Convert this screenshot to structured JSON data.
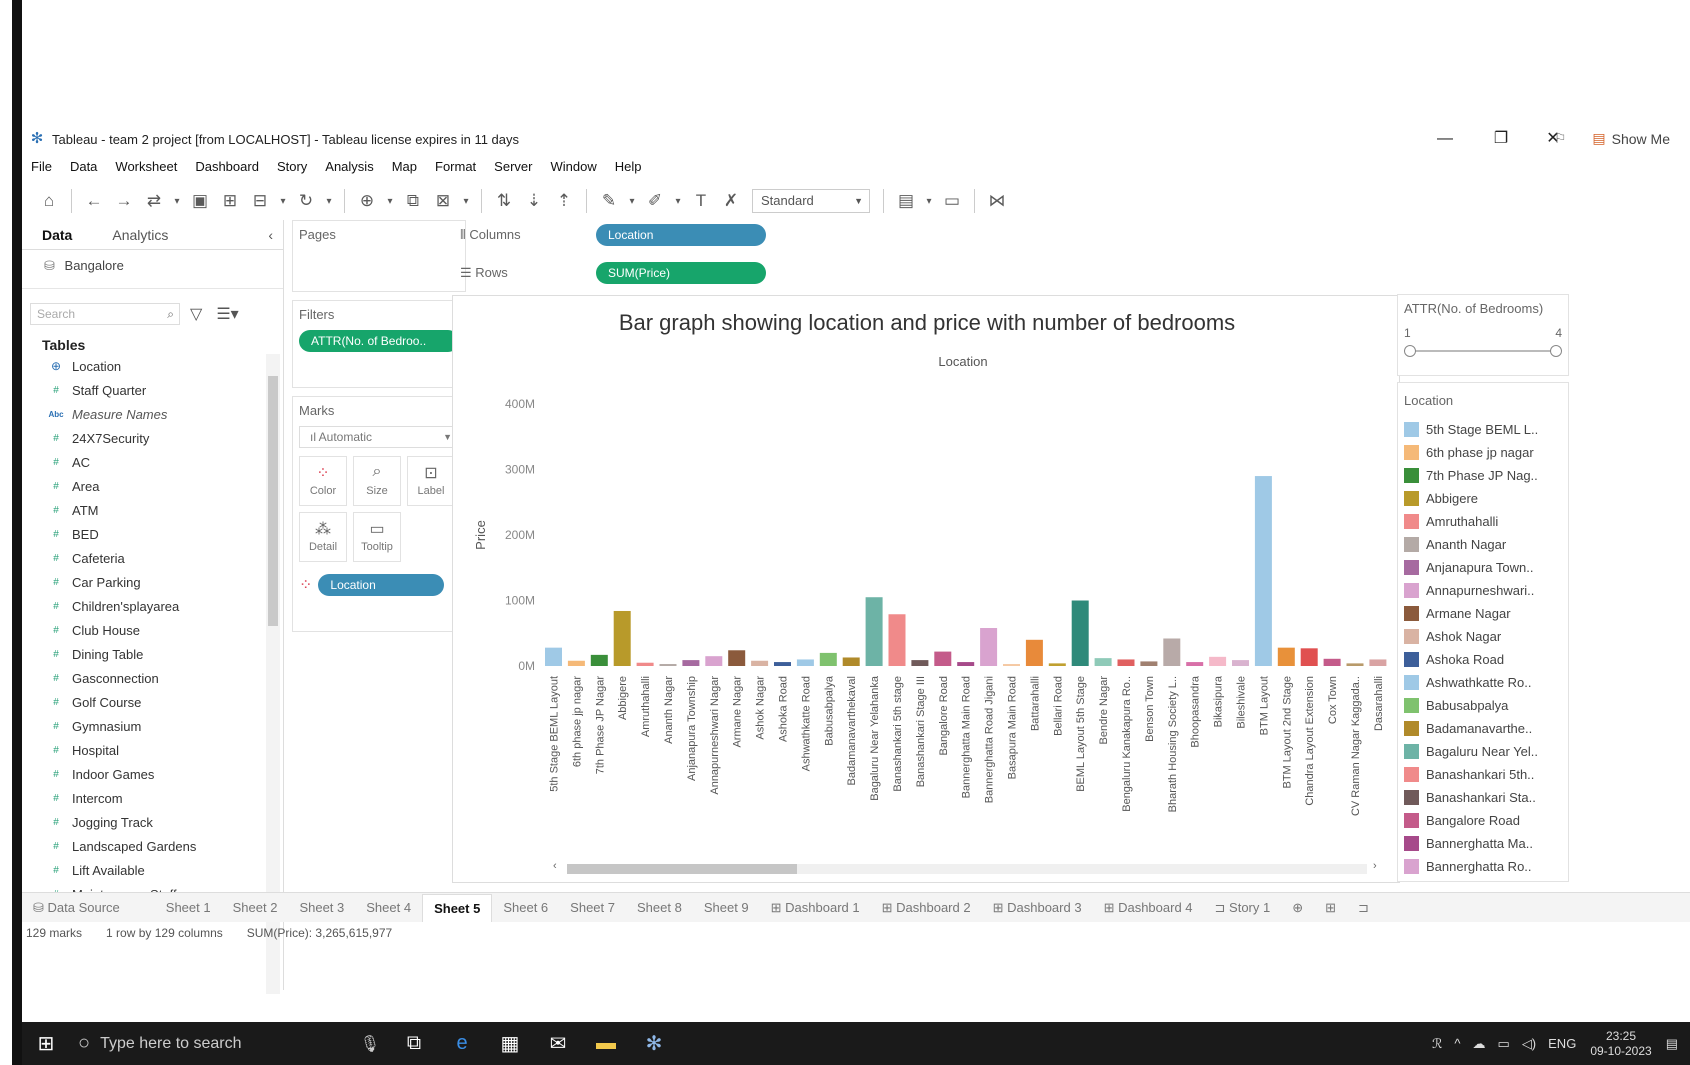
{
  "window": {
    "title": "Tableau - team 2 project [from LOCALHOST] - Tableau license expires in 11 days",
    "controls": [
      "—",
      "❐",
      "✕"
    ]
  },
  "menu": [
    "File",
    "Data",
    "Worksheet",
    "Dashboard",
    "Story",
    "Analysis",
    "Map",
    "Format",
    "Server",
    "Window",
    "Help"
  ],
  "toolbar": {
    "fit_select": "Standard",
    "show_me": "Show Me"
  },
  "data_pane": {
    "tabs": [
      "Data",
      "Analytics"
    ],
    "datasource": "Bangalore",
    "search_placeholder": "Search",
    "tables_heading": "Tables",
    "fields": [
      {
        "name": "Location",
        "type": "geo"
      },
      {
        "name": "Staff Quarter",
        "type": "num"
      },
      {
        "name": "Measure Names",
        "type": "abc"
      },
      {
        "name": "24X7Security",
        "type": "num"
      },
      {
        "name": "AC",
        "type": "num"
      },
      {
        "name": "Area",
        "type": "num"
      },
      {
        "name": "ATM",
        "type": "num"
      },
      {
        "name": "BED",
        "type": "num"
      },
      {
        "name": "Cafeteria",
        "type": "num"
      },
      {
        "name": "Car Parking",
        "type": "num"
      },
      {
        "name": "Children'splayarea",
        "type": "num"
      },
      {
        "name": "Club House",
        "type": "num"
      },
      {
        "name": "Dining Table",
        "type": "num"
      },
      {
        "name": "Gasconnection",
        "type": "num"
      },
      {
        "name": "Golf Course",
        "type": "num"
      },
      {
        "name": "Gymnasium",
        "type": "num"
      },
      {
        "name": "Hospital",
        "type": "num"
      },
      {
        "name": "Indoor Games",
        "type": "num"
      },
      {
        "name": "Intercom",
        "type": "num"
      },
      {
        "name": "Jogging Track",
        "type": "num"
      },
      {
        "name": "Landscaped Gardens",
        "type": "num"
      },
      {
        "name": "Lift Available",
        "type": "num"
      },
      {
        "name": "Maintenance Staff",
        "type": "num"
      }
    ]
  },
  "cards": {
    "pages_label": "Pages",
    "filters_label": "Filters",
    "filter_pill": "ATTR(No. of Bedroo..",
    "marks_label": "Marks",
    "mark_type": "Automatic",
    "mark_buttons": [
      "Color",
      "Size",
      "Label",
      "Detail",
      "Tooltip"
    ],
    "marks_pill": "Location"
  },
  "shelves": {
    "columns_label": "Columns",
    "columns_pill": "Location",
    "rows_label": "Rows",
    "rows_pill": "SUM(Price)"
  },
  "viz": {
    "title": "Bar graph showing location and price with number of bedrooms",
    "column_header": "Location",
    "y_axis_label": "Price"
  },
  "chart_data": {
    "type": "bar",
    "title": "Bar graph showing location and price with number of bedrooms",
    "xlabel": "Location",
    "ylabel": "Price",
    "ylim": [
      0,
      400
    ],
    "y_ticks": [
      "0M",
      "100M",
      "200M",
      "300M",
      "400M"
    ],
    "categories": [
      "5th Stage BEML Layout",
      "6th phase jp nagar",
      "7th Phase JP Nagar",
      "Abbigere",
      "Amruthahalli",
      "Ananth Nagar",
      "Anjanapura Township",
      "Annapurneshwari Nagar",
      "Armane Nagar",
      "Ashok Nagar",
      "Ashoka Road",
      "Ashwathkatte Road",
      "Babusabpalya",
      "Badamanavarthekaval",
      "Bagaluru Near Yelahanka",
      "Banashankari 5th stage",
      "Banashankari Stage III",
      "Bangalore Road",
      "Bannerghatta Main Road",
      "Bannerghatta Road Jigani",
      "Basapura Main Road",
      "Battarahalli",
      "Bellari Road",
      "BEML Layout 5th Stage",
      "Bendre Nagar",
      "Bengaluru Kanakapura Ro..",
      "Benson Town",
      "Bharath Housing Society L..",
      "Bhoopasandra",
      "Bikasipura",
      "Bileshivale",
      "BTM Layout",
      "BTM Layout 2nd Stage",
      "Chandra Layout Extension",
      "Cox Town",
      "CV Raman Nagar Kaggada..",
      "Dasarahalli"
    ],
    "values": [
      28,
      8,
      17,
      84,
      5,
      3,
      9,
      15,
      24,
      8,
      6,
      10,
      20,
      13,
      105,
      79,
      9,
      22,
      6,
      58,
      3,
      40,
      4,
      100,
      12,
      10,
      7,
      42,
      6,
      14,
      9,
      290,
      28,
      27,
      11,
      4,
      10
    ],
    "colors": [
      "#9fc9e6",
      "#f5b978",
      "#3a8f3a",
      "#b89a2a",
      "#f08a8a",
      "#b4aaa6",
      "#a66aa0",
      "#d9a3cf",
      "#8b5a3c",
      "#d9b3a3",
      "#3d5f9a",
      "#9fc9e6",
      "#7fc26e",
      "#b08a2a",
      "#6db3a6",
      "#f08a8a",
      "#705a5a",
      "#c45b8a",
      "#a64a8a",
      "#d9a3cf",
      "#f5c9a3",
      "#e88a3a",
      "#c0a030",
      "#2f8a7a",
      "#8fcab8",
      "#e06060",
      "#a08070",
      "#b8aaa8",
      "#d870a8",
      "#f5b9c9",
      "#d9b3cf",
      "#9fc9e6",
      "#e8913a",
      "#e05050",
      "#c45b8a",
      "#b89a6a",
      "#d9a3a3"
    ]
  },
  "legend": {
    "filter_title": "ATTR(No. of Bedrooms)",
    "range_min": "1",
    "range_max": "4",
    "color_title": "Location",
    "items": [
      {
        "label": "5th Stage BEML L..",
        "color": "#9fc9e6"
      },
      {
        "label": "6th phase jp nagar",
        "color": "#f5b978"
      },
      {
        "label": "7th Phase JP Nag..",
        "color": "#3a8f3a"
      },
      {
        "label": "Abbigere",
        "color": "#b89a2a"
      },
      {
        "label": "Amruthahalli",
        "color": "#f08a8a"
      },
      {
        "label": "Ananth Nagar",
        "color": "#b4aaa6"
      },
      {
        "label": "Anjanapura Town..",
        "color": "#a66aa0"
      },
      {
        "label": "Annapurneshwari..",
        "color": "#d9a3cf"
      },
      {
        "label": "Armane Nagar",
        "color": "#8b5a3c"
      },
      {
        "label": "Ashok Nagar",
        "color": "#d9b3a3"
      },
      {
        "label": "Ashoka Road",
        "color": "#3d5f9a"
      },
      {
        "label": "Ashwathkatte Ro..",
        "color": "#9fc9e6"
      },
      {
        "label": "Babusabpalya",
        "color": "#7fc26e"
      },
      {
        "label": "Badamanavarthe..",
        "color": "#b08a2a"
      },
      {
        "label": "Bagaluru Near Yel..",
        "color": "#6db3a6"
      },
      {
        "label": "Banashankari 5th..",
        "color": "#f08a8a"
      },
      {
        "label": "Banashankari Sta..",
        "color": "#705a5a"
      },
      {
        "label": "Bangalore Road",
        "color": "#c45b8a"
      },
      {
        "label": "Bannerghatta Ma..",
        "color": "#a64a8a"
      },
      {
        "label": "Bannerghatta Ro..",
        "color": "#d9a3cf"
      }
    ]
  },
  "sheet_tabs": [
    "Data Source",
    "Sheet 1",
    "Sheet 2",
    "Sheet 3",
    "Sheet 4",
    "Sheet 5",
    "Sheet 6",
    "Sheet 7",
    "Sheet 8",
    "Sheet 9",
    "Dashboard 1",
    "Dashboard 2",
    "Dashboard 3",
    "Dashboard 4",
    "Story 1"
  ],
  "active_sheet": "Sheet 5",
  "status": {
    "marks": "129 marks",
    "dims": "1 row by 129 columns",
    "sum": "SUM(Price): 3,265,615,977"
  },
  "taskbar": {
    "search_placeholder": "Type here to search",
    "lang": "ENG",
    "time": "23:25",
    "date": "09-10-2023"
  }
}
